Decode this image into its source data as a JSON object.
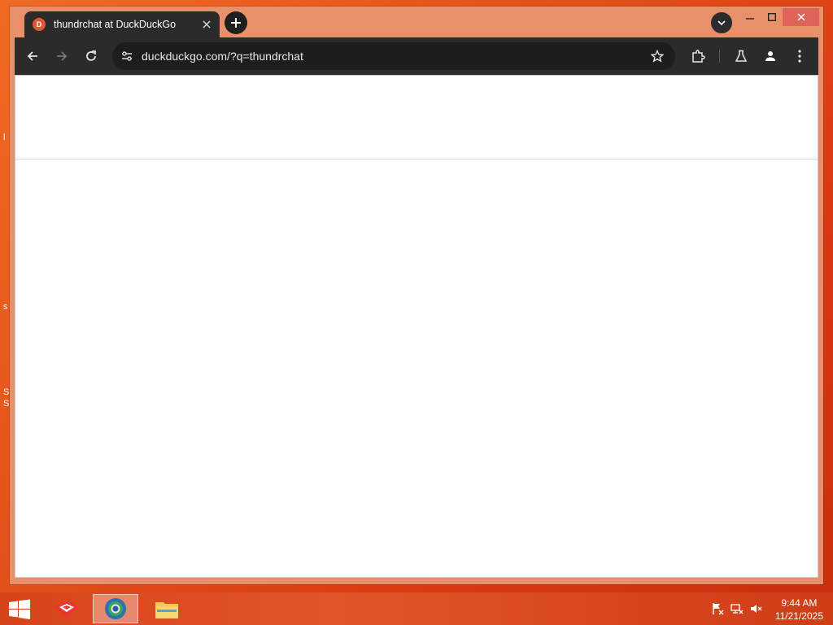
{
  "browser": {
    "tab": {
      "title": "thundrchat at DuckDuckGo",
      "favicon": "duckduckgo-icon",
      "close_icon": "close-icon"
    },
    "new_tab_icon": "plus-icon",
    "tab_search_icon": "chevron-down-icon",
    "window_controls": [
      "minimize-icon",
      "maximize-icon",
      "close-icon"
    ],
    "toolbar": {
      "back_icon": "arrow-left-icon",
      "forward_icon": "arrow-right-icon",
      "reload_icon": "reload-icon",
      "site_info_icon": "tune-icon",
      "url": "duckduckgo.com/?q=thundrchat",
      "bookmark_icon": "star-icon",
      "extensions_icon": "puzzle-icon",
      "labs_icon": "flask-icon",
      "profile_icon": "person-icon",
      "menu_icon": "kebab-menu-icon"
    }
  },
  "desktop": {
    "edge_glyphs": [
      "l",
      "s",
      "S",
      "S"
    ]
  },
  "taskbar": {
    "apps": [
      "start-icon",
      "app-icon-red",
      "browser-icon",
      "file-explorer-icon"
    ],
    "tray": [
      "flag-icon",
      "network-icon",
      "speaker-muted-icon"
    ],
    "clock": {
      "time": "9:44 AM",
      "date": "11/21/2025"
    }
  },
  "colors": {
    "accent": "#e8906a",
    "toolbar": "#2b2b2b",
    "desktop": "#e4501a",
    "close_hover": "#e0635a"
  }
}
